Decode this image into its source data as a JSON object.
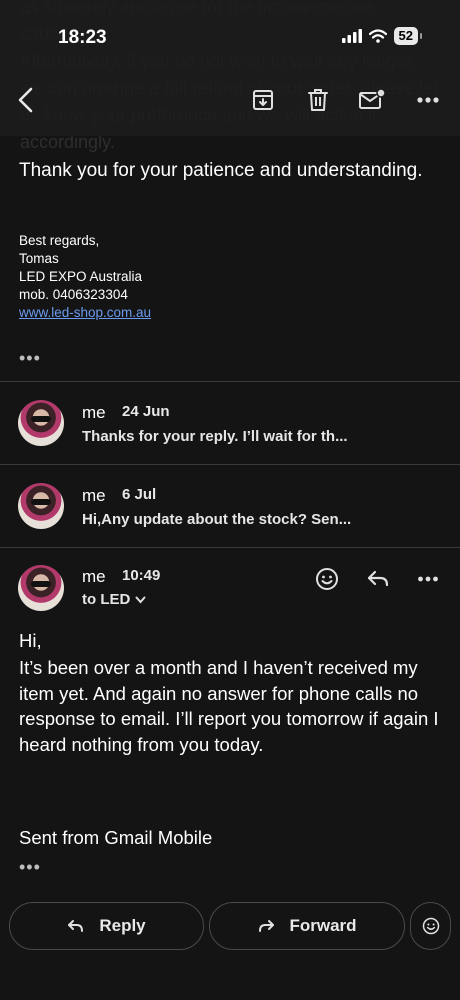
{
  "status_bar": {
    "time": "18:23",
    "battery": "52"
  },
  "background_text": "as sincerely apologise for the inconvenience caused.\nAlternatively, if you do not wish to wait any longer, we can arrange a full refund of your order. Please let us know your preference and we will action it accordingly.",
  "email_body": {
    "thanks": "Thank you for your patience and understanding.",
    "signature": {
      "greeting": "Best regards,",
      "name": "Tomas",
      "company": "LED EXPO Australia",
      "mobile": "mob. 0406323304",
      "website": "www.led-shop.com.au"
    }
  },
  "thread": [
    {
      "sender": "me",
      "date": "24 Jun",
      "snippet": "Thanks for your reply. I’ll wait for th..."
    },
    {
      "sender": "me",
      "date": "6 Jul",
      "snippet": "Hi,Any update about the stock? Sen..."
    }
  ],
  "expanded": {
    "sender": "me",
    "time": "10:49",
    "recipient": "to LED",
    "greeting": "Hi,",
    "body": "It’s been over a month and I haven’t received my item yet. And again no answer for phone calls no response to email. I’ll report you tomorrow if again I heard nothing from you today.",
    "footer": "Sent from Gmail Mobile"
  },
  "actions": {
    "reply_label": "Reply",
    "forward_label": "Forward"
  },
  "icons": {
    "toolbar": [
      "back-icon",
      "archive-icon",
      "trash-icon",
      "mark-unread-icon",
      "more-icon"
    ],
    "message": [
      "emoji-reaction-icon",
      "reply-icon",
      "more-icon"
    ]
  },
  "colors": {
    "background": "#141414",
    "toolbar": "#1c1c1d",
    "link": "#6b9bf0",
    "divider": "#3a3a3a"
  }
}
